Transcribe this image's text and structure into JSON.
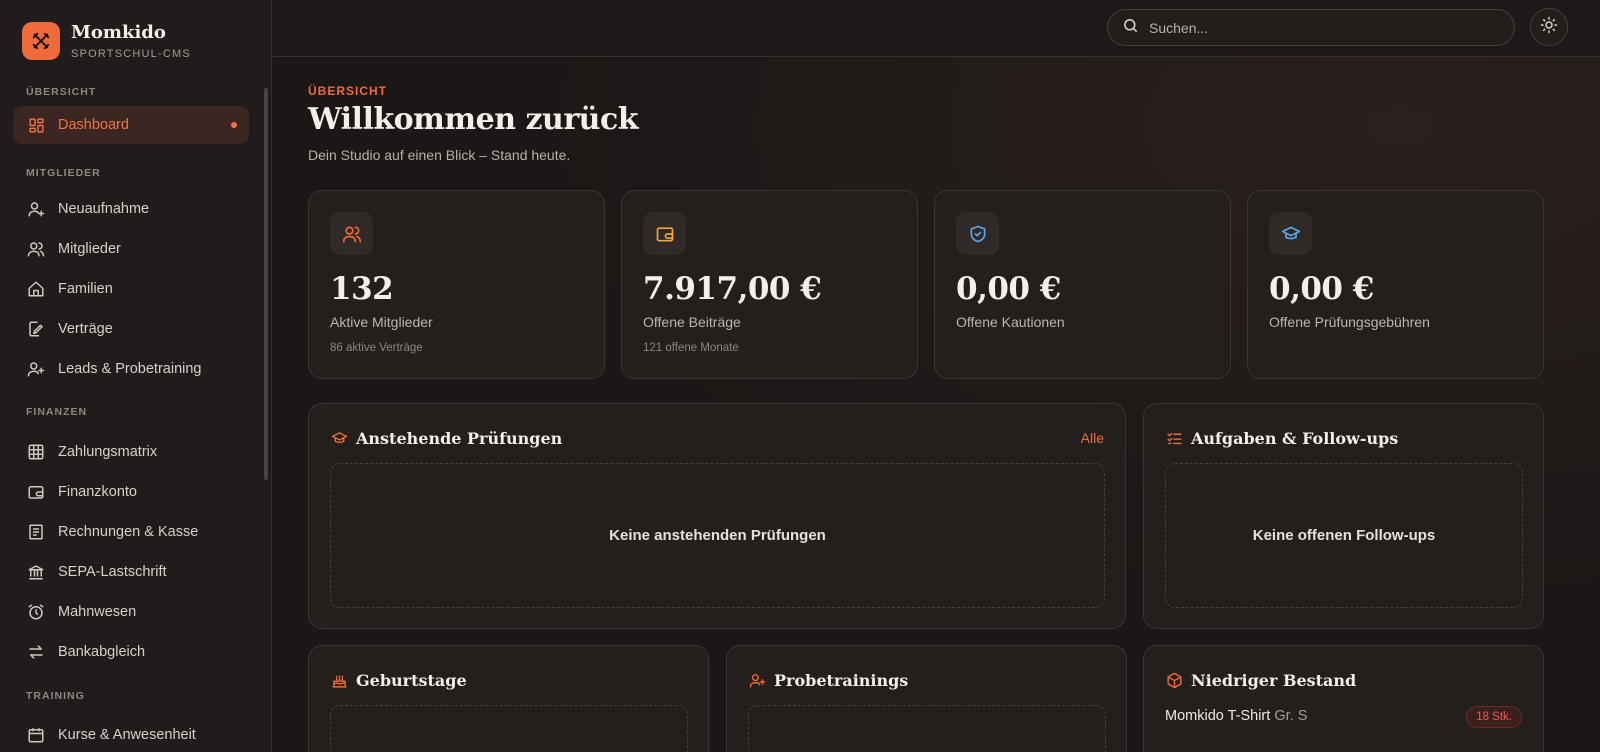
{
  "brand": {
    "name": "Momkido",
    "subtitle": "SPORTSCHUL-CMS"
  },
  "sidebar": {
    "sections": [
      {
        "title": "ÜBERSICHT",
        "items": [
          {
            "label": "Dashboard",
            "icon": "dashboard-icon",
            "active": true
          }
        ]
      },
      {
        "title": "MITGLIEDER",
        "items": [
          {
            "label": "Neuaufnahme",
            "icon": "user-plus-icon"
          },
          {
            "label": "Mitglieder",
            "icon": "users-icon"
          },
          {
            "label": "Familien",
            "icon": "home-icon"
          },
          {
            "label": "Verträge",
            "icon": "contract-edit-icon"
          },
          {
            "label": "Leads & Probetraining",
            "icon": "user-add-icon"
          }
        ]
      },
      {
        "title": "FINANZEN",
        "items": [
          {
            "label": "Zahlungsmatrix",
            "icon": "grid-icon"
          },
          {
            "label": "Finanzkonto",
            "icon": "wallet-icon"
          },
          {
            "label": "Rechnungen & Kasse",
            "icon": "receipt-icon"
          },
          {
            "label": "SEPA-Lastschrift",
            "icon": "bank-icon"
          },
          {
            "label": "Mahnwesen",
            "icon": "alarm-clock-icon"
          },
          {
            "label": "Bankabgleich",
            "icon": "arrows-swap-icon"
          }
        ]
      },
      {
        "title": "TRAINING",
        "items": [
          {
            "label": "Kurse & Anwesenheit",
            "icon": "calendar-icon"
          }
        ]
      }
    ]
  },
  "topbar": {
    "search_placeholder": "Suchen...",
    "theme_toggle_icon": "sun-icon"
  },
  "header": {
    "eyebrow": "ÜBERSICHT",
    "title": "Willkommen zurück",
    "subtitle": "Dein Studio auf einen Blick – Stand heute."
  },
  "stats": [
    {
      "value": "132",
      "label": "Aktive Mitglieder",
      "hint": "86 aktive Verträge",
      "icon": "users-icon",
      "color": "#ef6a3a"
    },
    {
      "value": "7.917,00 €",
      "label": "Offene Beiträge",
      "hint": "121 offene Monate",
      "icon": "wallet-icon",
      "color": "#f0a63a"
    },
    {
      "value": "0,00 €",
      "label": "Offene Kautionen",
      "hint": "",
      "icon": "shield-check-icon",
      "color": "#5aa8e6"
    },
    {
      "value": "0,00 €",
      "label": "Offene Prüfungsgebühren",
      "hint": "",
      "icon": "graduation-cap-icon",
      "color": "#5aa8e6"
    }
  ],
  "panels": {
    "exams": {
      "title": "Anstehende Prüfungen",
      "link": "Alle",
      "empty": "Keine anstehenden Prüfungen",
      "icon": "graduation-cap-icon"
    },
    "tasks": {
      "title": "Aufgaben & Follow-ups",
      "empty": "Keine offenen Follow-ups",
      "icon": "checklist-icon"
    },
    "birthdays": {
      "title": "Geburtstage",
      "icon": "cake-icon"
    },
    "trials": {
      "title": "Probetrainings",
      "icon": "user-plus-icon"
    },
    "stock": {
      "title": "Niedriger Bestand",
      "icon": "box-icon",
      "items": [
        {
          "name": "Momkido T-Shirt",
          "variant": "Gr. S",
          "qty": "18 Stk."
        }
      ]
    }
  },
  "colors": {
    "accent": "#ef6a3a",
    "background": "#1a1716",
    "card": "#221f1d",
    "danger": "#ef5a50"
  }
}
